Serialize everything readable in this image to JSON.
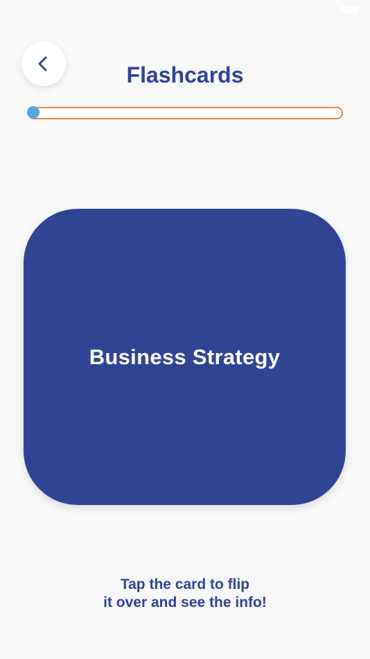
{
  "status_bar": {
    "carrier": "Network Provider",
    "time": "14:33"
  },
  "header": {
    "title": "Flashcards",
    "back_icon": "chevron-left-icon"
  },
  "progress": {
    "fraction": 0.02,
    "track_color": "#e1834a",
    "fill_color": "#5aa6d6"
  },
  "card": {
    "text": "Business Strategy",
    "color": "#314494"
  },
  "instruction": {
    "line1": "Tap the card to flip",
    "line2": "it over and see the info!"
  },
  "colors": {
    "brand": "#304495",
    "background": "#f8f8f8"
  }
}
